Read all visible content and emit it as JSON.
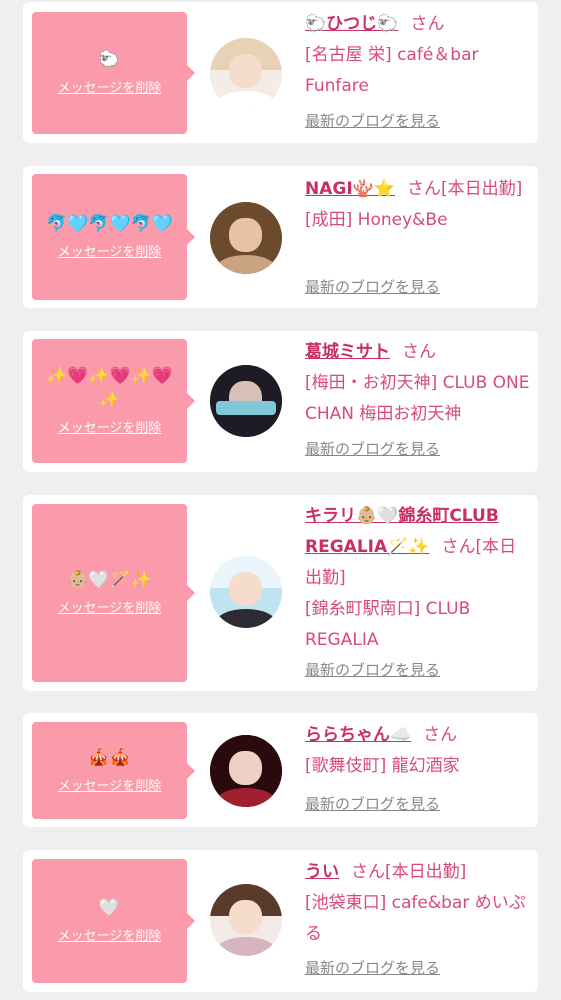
{
  "delete_label": "メッセージを削除",
  "blog_label": "最新のブログを見る",
  "san_label": "さん",
  "cards": [
    {
      "emoji": "🐑",
      "name": "🐑ひつじ🐑",
      "status": "",
      "shop": "[名古屋 栄] café＆bar Funfare"
    },
    {
      "emoji": "🐬🩵🐬🩵🐬🩵",
      "name": "NAGI🪸⭐",
      "status": "[本日出勤]",
      "shop": "[成田] Honey&Be"
    },
    {
      "emoji": "✨💗✨💗✨💗✨",
      "name": "葛城ミサト",
      "status": "",
      "shop": "[梅田・お初天神] CLUB ONE CHAN 梅田お初天神"
    },
    {
      "emoji": "👶🏼🤍🪄✨",
      "name": "キラリ👶🏼🤍錦糸町CLUB REGALIA🪄✨",
      "status": "[本日出勤]",
      "shop": "[錦糸町駅南口] CLUB REGALIA"
    },
    {
      "emoji": "🎪🎪",
      "name": "ららちゃん☁️",
      "status": "",
      "shop": "[歌舞伎町] 龍幻酒家"
    },
    {
      "emoji": "🤍",
      "name": "うい",
      "status": "[本日出勤]",
      "shop": "[池袋東口] cafe&bar めいぷる"
    }
  ]
}
